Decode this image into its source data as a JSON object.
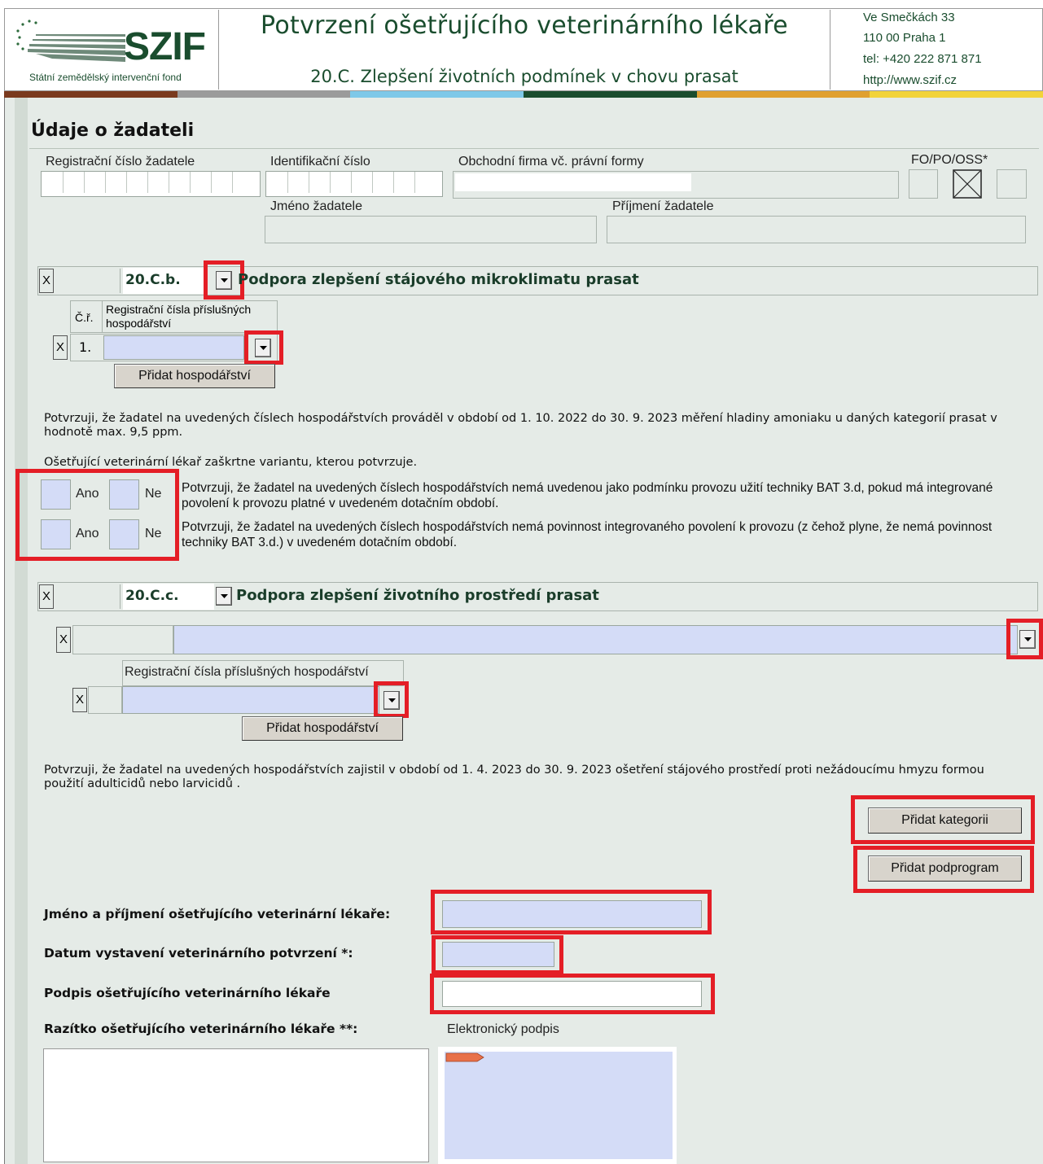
{
  "header": {
    "logo_text": "SZIF",
    "logo_subtitle": "Státní zemědělský intervenční fond",
    "title": "Potvrzení ošetřujícího veterinárního lékaře",
    "subtitle": "20.C. Zlepšení životních podmínek v chovu prasat",
    "contact": [
      "Ve Smečkách 33",
      "110 00 Praha 1",
      "tel: +420 222 871 871",
      "http://www.szif.cz"
    ]
  },
  "colors": {
    "bar": [
      "#7a3a1e",
      "#9b9b9b",
      "#7ec8e8",
      "#1a4d2e",
      "#e0a030",
      "#f2d33a"
    ],
    "highlight": "#e41e26",
    "field_blue": "#d4dcf7",
    "page_bg": "#e5ebe7",
    "title_green": "#1a4d2e"
  },
  "applicant": {
    "heading": "Údaje o žadateli",
    "reg_label": "Registrační číslo žadatele",
    "id_label": "Identifikační číslo",
    "firm_label": "Obchodní firma vč. právní formy",
    "type_label": "FO/PO/OSS*",
    "first_name_label": "Jméno žadatele",
    "last_name_label": "Příjmení žadatele"
  },
  "section_b": {
    "x": "X",
    "code": "20.C.b.",
    "title": "Podpora zlepšení stájového mikroklimatu prasat",
    "col_no": "Č.ř.",
    "col_reg": "Registrační čísla příslušných hospodářství",
    "row_x": "X",
    "row_no": "1.",
    "add_farm": "Přidat hospodářství",
    "confirm_text": "Potvrzuji, že žadatel na uvedených číslech hospodářstvích prováděl v období od 1. 10. 2022 do 30. 9. 2023 měření hladiny amoniaku u daných kategorií prasat v hodnotě max. 9,5 ppm.",
    "vet_note": "Ošetřující veterinární lékař zaškrtne variantu, kterou potvrzuje.",
    "yes": "Ano",
    "no": "Ne",
    "option1": "Potvrzuji, že žadatel na uvedených číslech hospodářstvích nemá uvedenou jako podmínku provozu užití techniky BAT 3.d, pokud má integrované povolení k provozu platné v uvedeném dotačním období.",
    "option2": "Potvrzuji, že žadatel na uvedených číslech hospodářstvích nemá povinnost integrovaného povolení k provozu (z čehož plyne, že nemá povinnost techniky BAT 3.d.) v uvedeném dotačním období."
  },
  "section_c": {
    "x": "X",
    "code": "20.C.c.",
    "title": "Podpora zlepšení životního prostředí prasat",
    "sub_x": "X",
    "col_reg": "Registrační čísla příslušných hospodářství",
    "row_x": "X",
    "add_farm": "Přidat hospodářství",
    "confirm_text": "Potvrzuji, že žadatel na uvedených hospodářstvích zajistil v období od 1. 4. 2023 do 30. 9. 2023 ošetření stájového prostředí proti nežádoucímu hmyzu formou použití adulticidů nebo larvicidů ."
  },
  "buttons": {
    "add_category": "Přidat kategorii",
    "add_subprogram": "Přidat podprogram"
  },
  "vet": {
    "name_label": "Jméno a příjmení ošetřujícího veterinární lékaře:",
    "date_label": "Datum vystavení veterinárního potvrzení *:",
    "signature_label": "Podpis ošetřujícího veterinárního lékaře",
    "stamp_label": "Razítko ošetřujícího veterinárního lékaře **:",
    "esign_label": "Elektronický podpis"
  }
}
